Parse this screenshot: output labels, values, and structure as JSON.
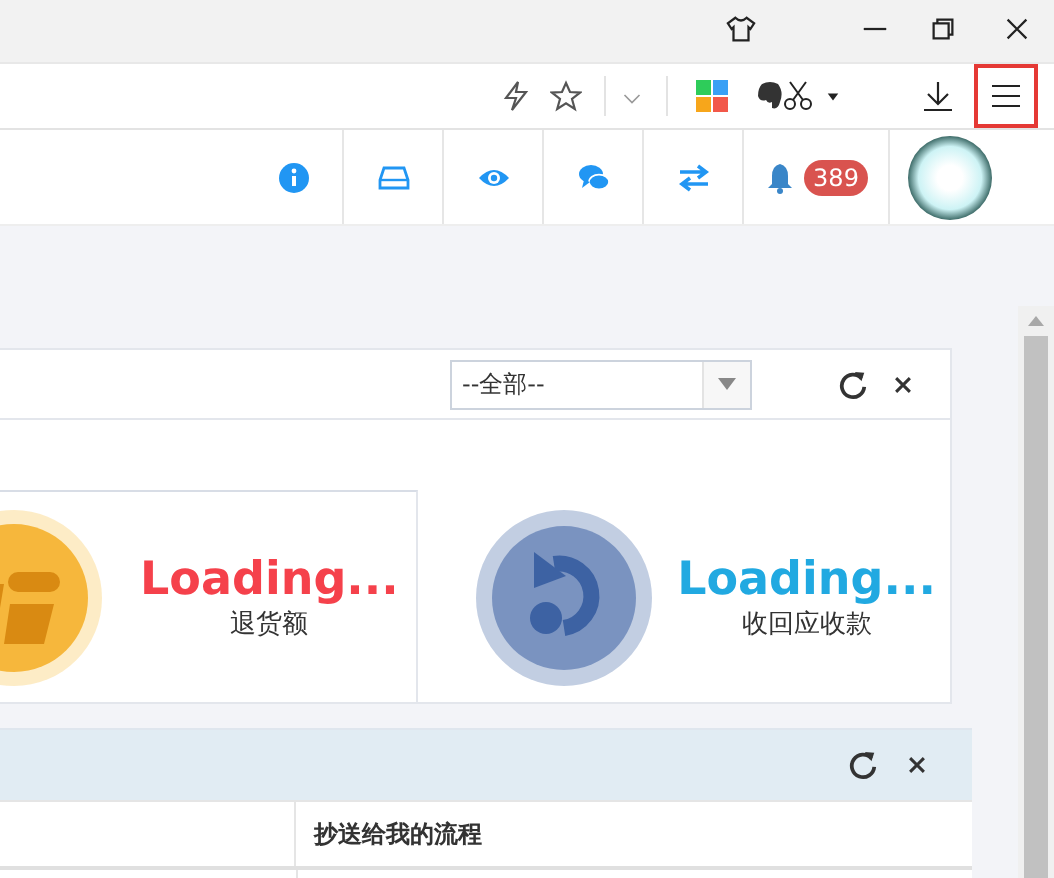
{
  "notifications": {
    "badge": "389"
  },
  "filter_panel": {
    "select": {
      "value": "--全部--"
    }
  },
  "stats": [
    {
      "kind": "return",
      "value": "Loading...",
      "label": "退货额",
      "color": "#f5414b"
    },
    {
      "kind": "receivable",
      "value": "Loading...",
      "label": "收回应收款",
      "color": "#21a9e1"
    }
  ],
  "process_panel": {
    "columns": [
      "抄送给我的流程"
    ]
  }
}
